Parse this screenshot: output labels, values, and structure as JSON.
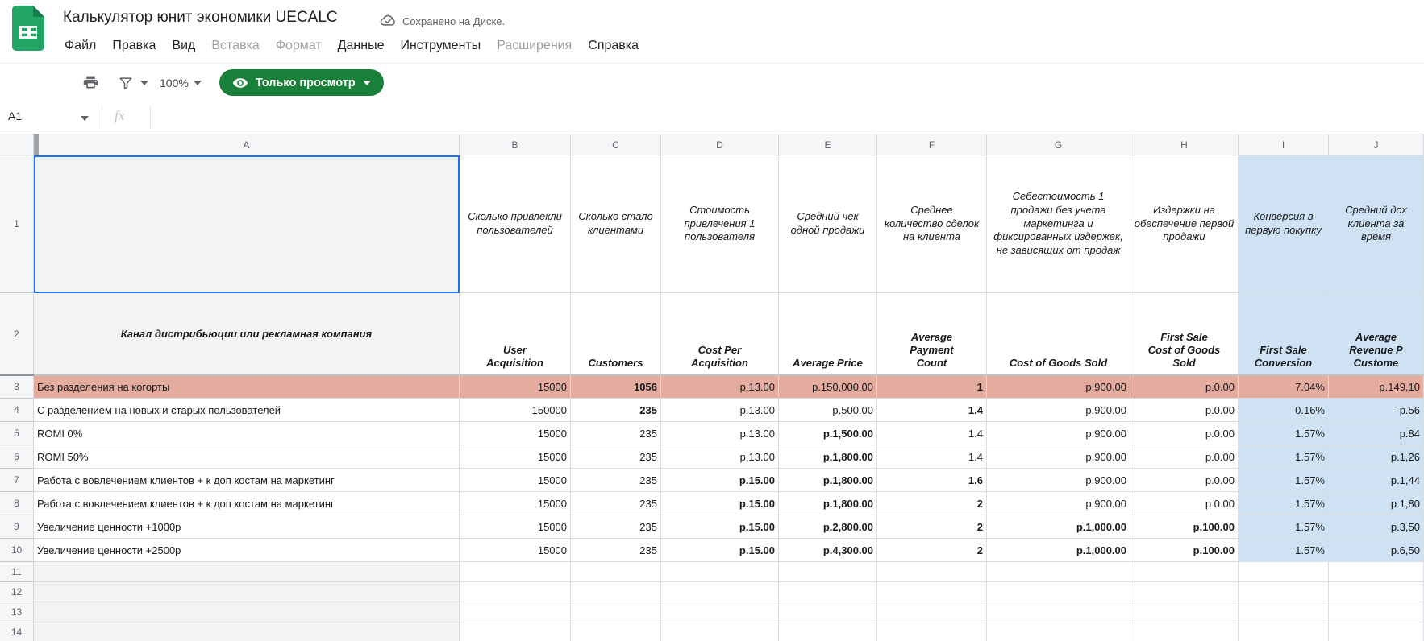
{
  "header": {
    "title": "Калькулятор юнит экономики UECALC",
    "save_status": "Сохранено на Диске.",
    "menu": [
      {
        "label": "Файл",
        "enabled": true
      },
      {
        "label": "Правка",
        "enabled": true
      },
      {
        "label": "Вид",
        "enabled": true
      },
      {
        "label": "Вставка",
        "enabled": false
      },
      {
        "label": "Формат",
        "enabled": false
      },
      {
        "label": "Данные",
        "enabled": true
      },
      {
        "label": "Инструменты",
        "enabled": true
      },
      {
        "label": "Расширения",
        "enabled": false
      },
      {
        "label": "Справка",
        "enabled": true
      }
    ]
  },
  "toolbar": {
    "zoom_level": "100%",
    "view_mode_label": "Только просмотр"
  },
  "formula_bar": {
    "name_box": "A1",
    "fx_label": "fx"
  },
  "colors": {
    "pill_green": "#188038",
    "selection_blue": "#1a73e8",
    "row3_fill": "#e4ab9f",
    "blue_col_fill": "#cfe2f3",
    "gray_cell_fill": "#f3f3f3"
  },
  "sheet": {
    "column_letters": [
      "A",
      "B",
      "C",
      "D",
      "E",
      "F",
      "G",
      "H",
      "I",
      "J"
    ],
    "blue_columns": [
      "I",
      "J"
    ],
    "header_row_ru": {
      "A": "",
      "B": "Сколько привлекли пользователей",
      "C": "Сколько стало клиентами",
      "D": "Стоимость привлечения 1 пользователя",
      "E": "Средний чек одной продажи",
      "F": "Среднее количество сделок на клиента",
      "G": "Себестоимость 1 продажи без учета маркетинга и фиксированных издержек, не зависящих от продаж",
      "H": "Издержки на обеспечение первой продажи",
      "I": "Конверсия в первую покупку",
      "J": "Средний дох\nклиента за\nвремя"
    },
    "header_row_en": {
      "A": "Канал дистрибьюции или рекламная компания",
      "B": "User\nAcquisition",
      "C": "Customers",
      "D": "Cost Per\nAcquisition",
      "E": "Average Price",
      "F": "Average\nPayment\nCount",
      "G": "Cost of Goods Sold",
      "H": "First Sale\nCost of Goods\nSold",
      "I": "First Sale\nConversion",
      "J": "Average\nRevenue P\nCustome"
    },
    "data_rows": [
      {
        "row": 3,
        "fill": "pink",
        "bold": [
          "C",
          "F"
        ],
        "cells": {
          "A": "Без разделения на когорты",
          "B": "15000",
          "C": "1056",
          "D": "p.13.00",
          "E": "p.150,000.00",
          "F": "1",
          "G": "p.900.00",
          "H": "p.0.00",
          "I": "7.04%",
          "J": "p.149,10"
        }
      },
      {
        "row": 4,
        "bold": [
          "C",
          "F"
        ],
        "cells": {
          "A": "С разделением на новых и старых пользователей",
          "B": "150000",
          "C": "235",
          "D": "p.13.00",
          "E": "p.500.00",
          "F": "1.4",
          "G": "p.900.00",
          "H": "p.0.00",
          "I": "0.16%",
          "J": "-p.56"
        }
      },
      {
        "row": 5,
        "bold": [
          "E"
        ],
        "cells": {
          "A": "ROMI 0%",
          "B": "15000",
          "C": "235",
          "D": "p.13.00",
          "E": "p.1,500.00",
          "F": "1.4",
          "G": "p.900.00",
          "H": "p.0.00",
          "I": "1.57%",
          "J": "p.84"
        }
      },
      {
        "row": 6,
        "bold": [
          "E"
        ],
        "cells": {
          "A": "ROMI 50%",
          "B": "15000",
          "C": "235",
          "D": "p.13.00",
          "E": "p.1,800.00",
          "F": "1.4",
          "G": "p.900.00",
          "H": "p.0.00",
          "I": "1.57%",
          "J": "p.1,26"
        }
      },
      {
        "row": 7,
        "bold": [
          "D",
          "E",
          "F"
        ],
        "cells": {
          "A": "Работа с вовлечением клиентов + к доп костам на маркетинг",
          "B": "15000",
          "C": "235",
          "D": "p.15.00",
          "E": "p.1,800.00",
          "F": "1.6",
          "G": "p.900.00",
          "H": "p.0.00",
          "I": "1.57%",
          "J": "p.1,44"
        }
      },
      {
        "row": 8,
        "bold": [
          "D",
          "E",
          "F"
        ],
        "cells": {
          "A": "Работа с вовлечением клиентов + к доп костам на маркетинг",
          "B": "15000",
          "C": "235",
          "D": "p.15.00",
          "E": "p.1,800.00",
          "F": "2",
          "G": "p.900.00",
          "H": "p.0.00",
          "I": "1.57%",
          "J": "p.1,80"
        }
      },
      {
        "row": 9,
        "bold": [
          "D",
          "E",
          "F",
          "G",
          "H"
        ],
        "cells": {
          "A": "Увеличение ценности +1000р",
          "B": "15000",
          "C": "235",
          "D": "p.15.00",
          "E": "p.2,800.00",
          "F": "2",
          "G": "p.1,000.00",
          "H": "p.100.00",
          "I": "1.57%",
          "J": "p.3,50"
        }
      },
      {
        "row": 10,
        "bold": [
          "D",
          "E",
          "F",
          "G",
          "H"
        ],
        "cells": {
          "A": "Увеличение ценности +2500р",
          "B": "15000",
          "C": "235",
          "D": "p.15.00",
          "E": "p.4,300.00",
          "F": "2",
          "G": "p.1,000.00",
          "H": "p.100.00",
          "I": "1.57%",
          "J": "p.6,50"
        }
      }
    ],
    "empty_row_numbers": [
      11,
      12,
      13,
      14
    ],
    "selected_cell": "A1"
  }
}
